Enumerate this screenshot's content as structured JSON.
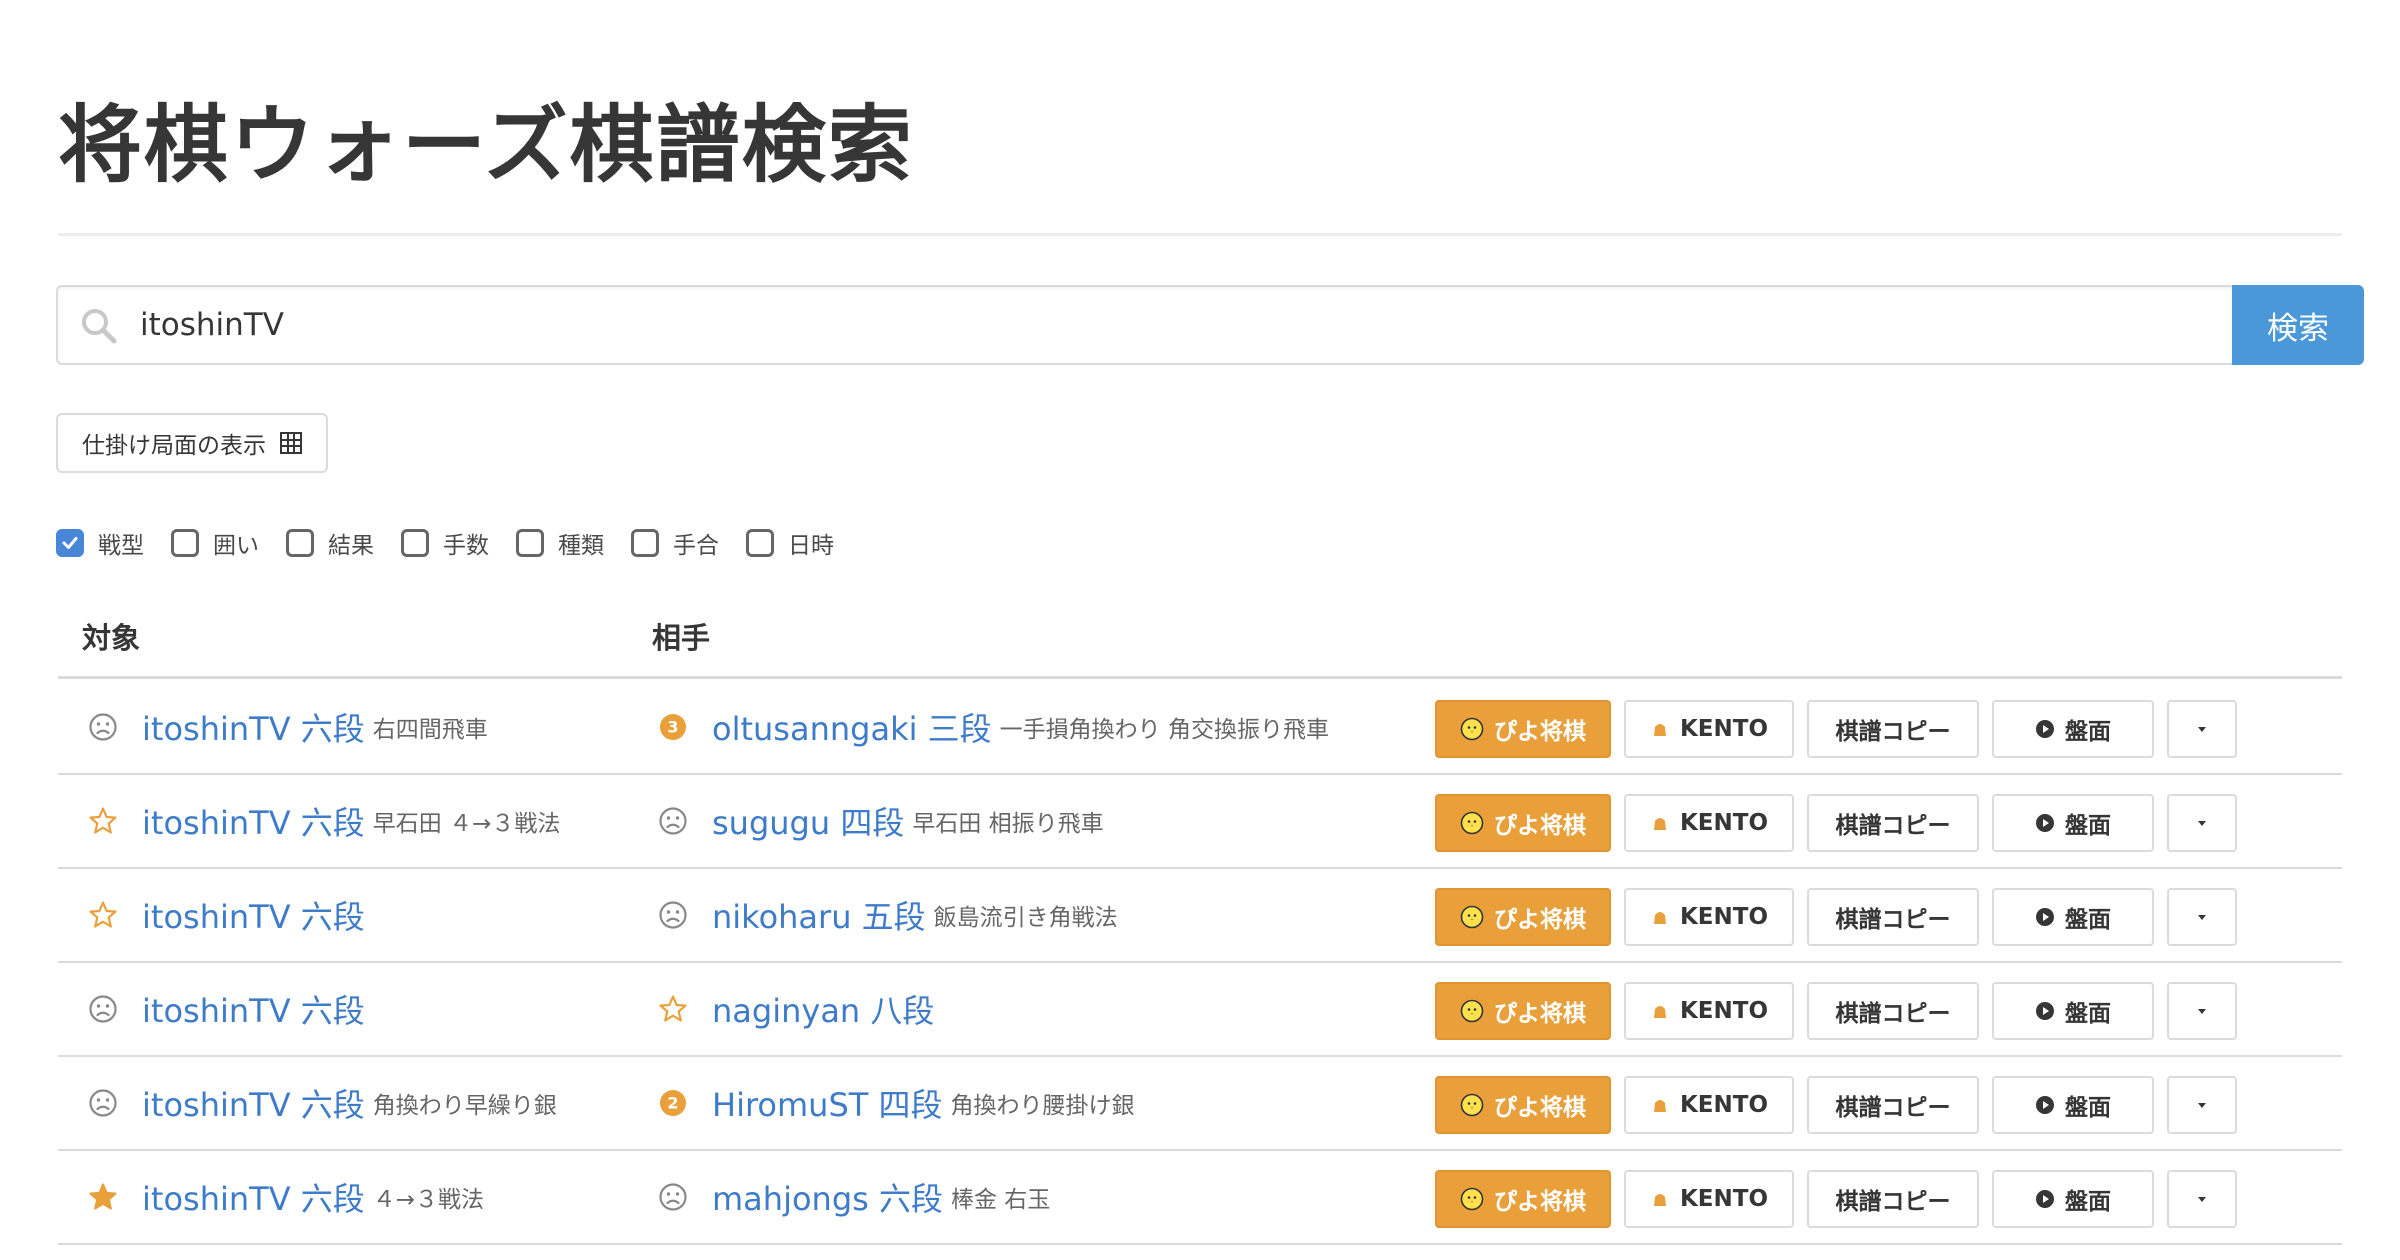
{
  "title": "将棋ウォーズ棋譜検索",
  "search": {
    "value": "itoshinTV",
    "button_label": "検索",
    "icon": "search-icon"
  },
  "trap_button": {
    "label": "仕掛け局面の表示",
    "icon": "grid-icon"
  },
  "filters": [
    {
      "label": "戦型",
      "checked": true
    },
    {
      "label": "囲い",
      "checked": false
    },
    {
      "label": "結果",
      "checked": false
    },
    {
      "label": "手数",
      "checked": false
    },
    {
      "label": "種類",
      "checked": false
    },
    {
      "label": "手合",
      "checked": false
    },
    {
      "label": "日時",
      "checked": false
    }
  ],
  "columns": {
    "target": "対象",
    "opponent": "相手"
  },
  "row_buttons": {
    "piyo": "ぴよ将棋",
    "kento": "KENTO",
    "copy": "棋譜コピー",
    "board": "盤面"
  },
  "rows": [
    {
      "target": {
        "status": "sad-face-icon",
        "name": "itoshinTV 六段",
        "tags": "右四間飛車"
      },
      "opponent": {
        "status": "badge-3-icon",
        "badge": "3",
        "name": "oltusanngaki 三段",
        "tags": "一手損角換わり 角交換振り飛車"
      }
    },
    {
      "target": {
        "status": "star-outline-icon",
        "name": "itoshinTV 六段",
        "tags": "早石田 ４→３戦法"
      },
      "opponent": {
        "status": "sad-face-icon",
        "name": "sugugu 四段",
        "tags": "早石田 相振り飛車"
      }
    },
    {
      "target": {
        "status": "star-outline-icon",
        "name": "itoshinTV 六段",
        "tags": ""
      },
      "opponent": {
        "status": "sad-face-icon",
        "name": "nikoharu 五段",
        "tags": "飯島流引き角戦法"
      }
    },
    {
      "target": {
        "status": "sad-face-icon",
        "name": "itoshinTV 六段",
        "tags": ""
      },
      "opponent": {
        "status": "star-outline-icon",
        "name": "naginyan 八段",
        "tags": ""
      }
    },
    {
      "target": {
        "status": "sad-face-icon",
        "name": "itoshinTV 六段",
        "tags": "角換わり早繰り銀"
      },
      "opponent": {
        "status": "badge-2-icon",
        "badge": "2",
        "name": "HiromuST 四段",
        "tags": "角換わり腰掛け銀"
      }
    },
    {
      "target": {
        "status": "star-filled-icon",
        "name": "itoshinTV 六段",
        "tags": "４→３戦法"
      },
      "opponent": {
        "status": "sad-face-icon",
        "name": "mahjongs 六段",
        "tags": "棒金 右玉"
      }
    }
  ],
  "colors": {
    "accent": "#4a98d8",
    "link": "#3e7cc9",
    "piyo": "#e9a03b",
    "star": "#e9a03b"
  }
}
